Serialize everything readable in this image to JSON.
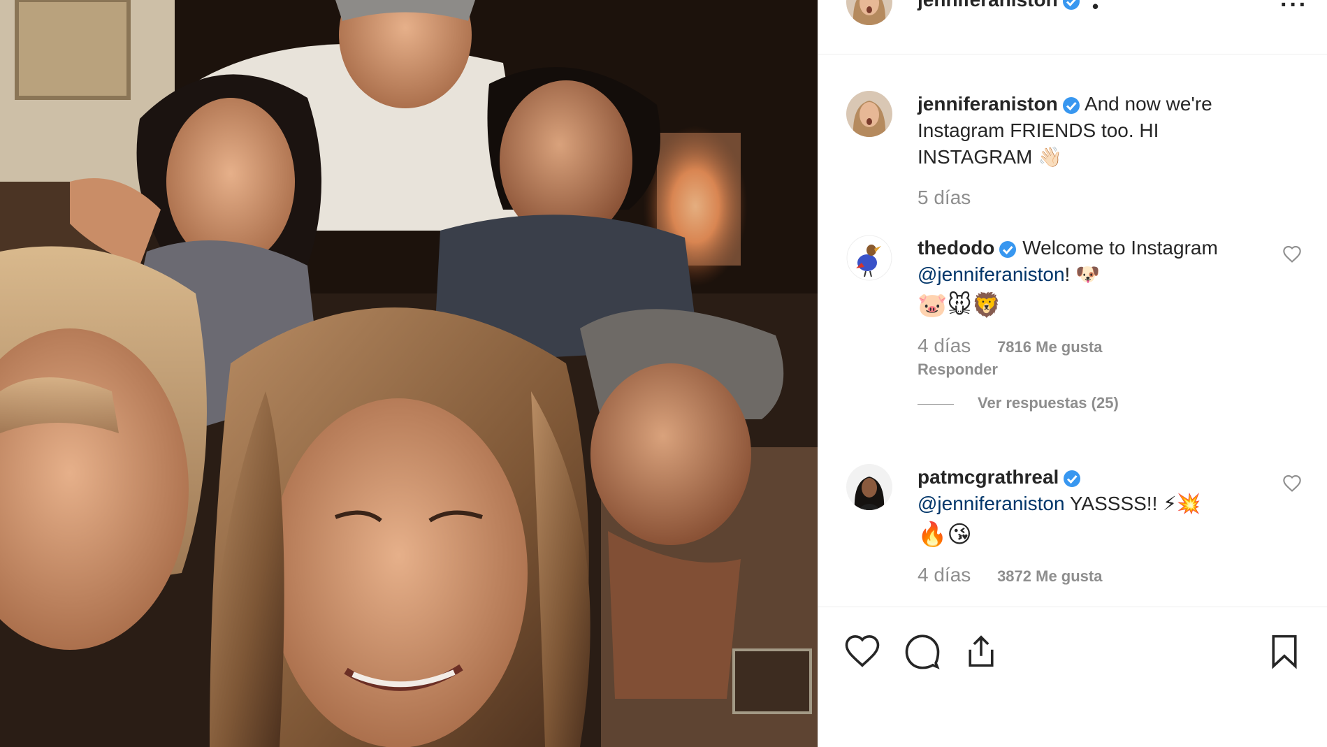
{
  "header": {
    "username": "jenniferaniston",
    "separator": "•",
    "more_icon": "more-options-icon",
    "more_label": "···"
  },
  "caption": {
    "username": "jenniferaniston",
    "text": "And now we're Instagram FRIENDS too. HI INSTAGRAM",
    "emoji": "👋🏻",
    "time": "5 días"
  },
  "comments": [
    {
      "username": "thedodo",
      "text_before": "Welcome to Instagram",
      "mention": "@jenniferaniston",
      "text_after": "!",
      "emoji_line1": "🐶",
      "emoji_line2": "🐷🐭🦁",
      "time": "4 días",
      "likes": "7816 Me gusta",
      "reply": "Responder",
      "view_replies": "Ver respuestas (25)"
    },
    {
      "username": "patmcgrathreal",
      "mention": "@jenniferaniston",
      "text_after": "YASSSS!!",
      "emoji_line1": "⚡💥",
      "emoji_line2": "🔥😘",
      "time": "4 días",
      "likes": "3872 Me gusta"
    }
  ],
  "actions": {
    "like_icon": "heart-icon",
    "comment_icon": "comment-icon",
    "share_icon": "share-icon",
    "save_icon": "bookmark-icon"
  },
  "colors": {
    "verified": "#3897f0",
    "text": "#262626",
    "muted": "#8e8e8e",
    "mention": "#003569",
    "border": "#efefef"
  }
}
